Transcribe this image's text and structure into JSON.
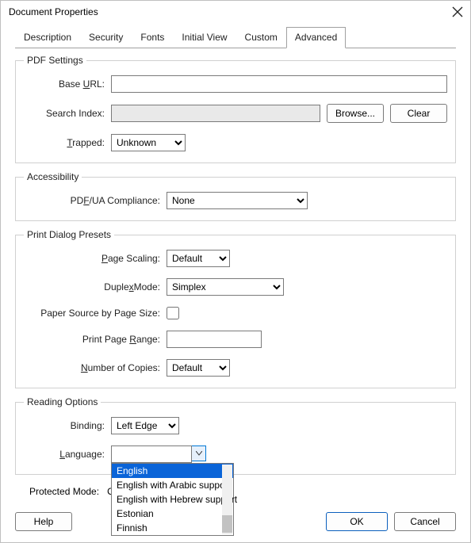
{
  "title": "Document Properties",
  "tabs": {
    "t0": "Description",
    "t1": "Security",
    "t2": "Fonts",
    "t3": "Initial View",
    "t4": "Custom",
    "t5": "Advanced"
  },
  "pdf_settings": {
    "legend": "PDF Settings",
    "base_url_label_pre": "Base ",
    "base_url_label_u": "U",
    "base_url_label_post": "RL:",
    "base_url_value": "",
    "search_index_label": "Search Index:",
    "search_index_value": "",
    "browse_label_u": "B",
    "browse_label_post": "rowse...",
    "clear_label": "Clear",
    "trapped_label_u": "T",
    "trapped_label_post": "rapped:",
    "trapped_value": "Unknown"
  },
  "accessibility": {
    "legend": "Accessibility",
    "label_pre": "PD",
    "label_u": "F",
    "label_post": "/UA Compliance:",
    "value": "None"
  },
  "print_presets": {
    "legend": "Print Dialog Presets",
    "page_scaling_label_u": "P",
    "page_scaling_label_post": "age Scaling:",
    "page_scaling_value": "Default",
    "duplex_label_pre": "Duple",
    "duplex_label_u": "x",
    "duplex_label_post": "Mode:",
    "duplex_value": "Simplex",
    "paper_source_label": "Paper Source by Page Size:",
    "range_label_pre": "Print Page ",
    "range_label_u": "R",
    "range_label_post": "ange:",
    "range_value": "",
    "copies_label_u": "N",
    "copies_label_post": "umber of Copies:",
    "copies_value": "Default"
  },
  "reading": {
    "legend": "Reading Options",
    "binding_label": "Binding:",
    "binding_value": "Left Edge",
    "language_label_u": "L",
    "language_label_post": "anguage:",
    "language_value": "",
    "options": {
      "o0": "English",
      "o1": "English with Arabic support",
      "o2": "English with Hebrew support",
      "o3": "Estonian",
      "o4": "Finnish"
    }
  },
  "protected_mode": {
    "label": "Protected Mode:",
    "value": "On"
  },
  "buttons": {
    "help": "Help",
    "ok": "OK",
    "cancel": "Cancel"
  }
}
